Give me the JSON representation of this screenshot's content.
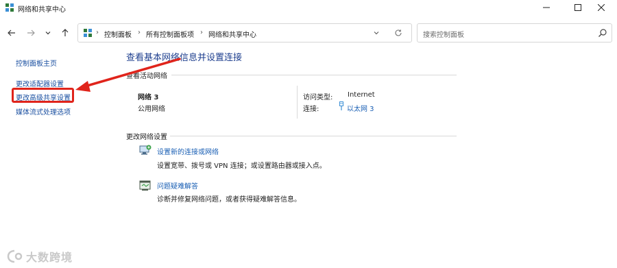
{
  "window": {
    "title": "网络和共享中心",
    "minimize_label": "minimize",
    "maximize_label": "maximize",
    "close_label": "close"
  },
  "address": {
    "crumbs": [
      "控制面板",
      "所有控制面板项",
      "网络和共享中心"
    ],
    "separator": "›"
  },
  "search": {
    "placeholder": "搜索控制面板"
  },
  "sidebar": {
    "items": [
      {
        "label": "控制面板主页"
      },
      {
        "label": "更改适配器设置"
      },
      {
        "label": "更改高级共享设置"
      },
      {
        "label": "媒体流式处理选项"
      }
    ]
  },
  "main": {
    "heading": "查看基本网络信息并设置连接",
    "active_section_title": "查看活动网络",
    "network_name": "网络  3",
    "network_type": "公用网络",
    "access_type_label": "访问类型:",
    "access_type_value": "Internet",
    "connection_label": "连接:",
    "connection_value": "以太网  3",
    "change_section_title": "更改网络设置",
    "tasks": [
      {
        "link": "设置新的连接或网络",
        "desc": "设置宽带、拨号或 VPN 连接；或设置路由器或接入点。"
      },
      {
        "link": "问题疑难解答",
        "desc": "诊断并修复网络问题，或者获得疑难解答信息。"
      }
    ]
  },
  "annotation": {
    "box_color": "#e0241b",
    "arrow_color": "#e0241b"
  },
  "watermark": {
    "text": "大数跨境"
  },
  "icons": {
    "title": "network-center-icon",
    "back": "arrow-left-icon",
    "forward": "arrow-right-icon",
    "recent": "chevron-down-icon",
    "up": "arrow-up-icon",
    "refresh": "refresh-icon",
    "search": "search-icon"
  }
}
